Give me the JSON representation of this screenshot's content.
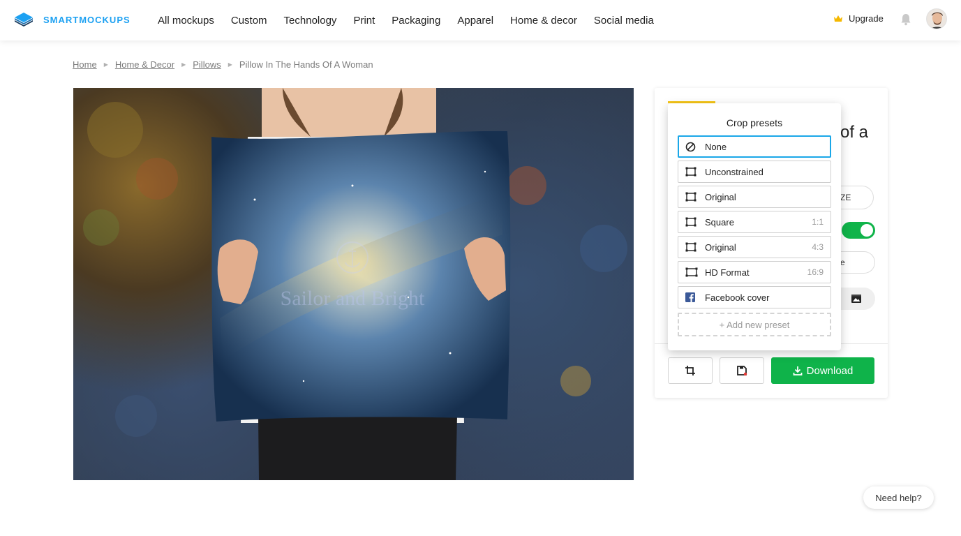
{
  "header": {
    "brand": "SMARTMOCKUPS",
    "nav": [
      "All mockups",
      "Custom",
      "Technology",
      "Print",
      "Packaging",
      "Apparel",
      "Home & decor",
      "Social media"
    ],
    "upgrade_label": "Upgrade"
  },
  "breadcrumb": {
    "items": [
      "Home",
      "Home & Decor",
      "Pillows"
    ],
    "current": "Pillow In The Hands Of A Woman"
  },
  "mockup": {
    "watermark_text": "Sailor and Bright"
  },
  "panel": {
    "title_fragment": "of a",
    "pill1_fragment": "ZE",
    "toggle_on": true,
    "pill2_fragment": "e",
    "download_label": "Download",
    "accent_color": "#f5c518",
    "download_color": "#0fb34a"
  },
  "crop_presets": {
    "title": "Crop presets",
    "items": [
      {
        "label": "None",
        "ratio": "",
        "icon": "none-icon",
        "active": true
      },
      {
        "label": "Unconstrained",
        "ratio": "",
        "icon": "crop-frame-icon"
      },
      {
        "label": "Original",
        "ratio": "",
        "icon": "crop-frame-icon"
      },
      {
        "label": "Square",
        "ratio": "1:1",
        "icon": "crop-frame-icon"
      },
      {
        "label": "Original",
        "ratio": "4:3",
        "icon": "crop-frame-icon"
      },
      {
        "label": "HD Format",
        "ratio": "16:9",
        "icon": "crop-frame-icon"
      },
      {
        "label": "Facebook cover",
        "ratio": "",
        "icon": "facebook-icon"
      }
    ],
    "add_label": "+ Add new preset",
    "active_color": "#1aa7e8"
  },
  "help": {
    "label": "Need help?"
  }
}
